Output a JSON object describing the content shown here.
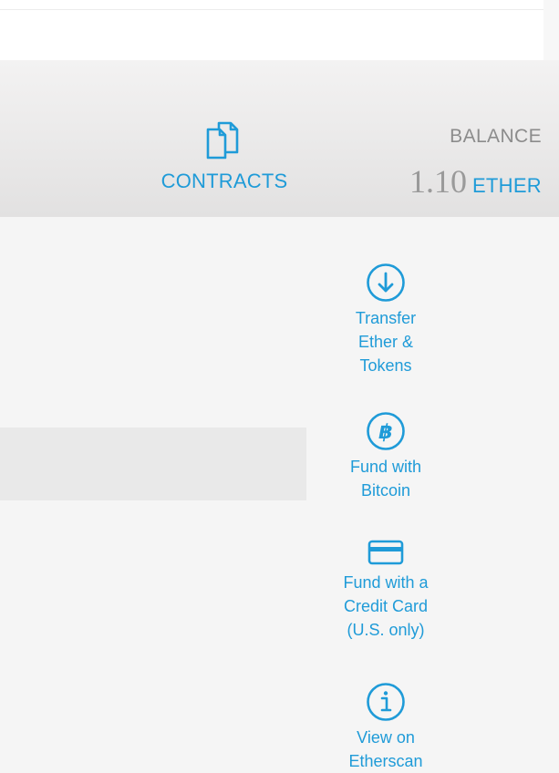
{
  "header": {
    "contracts_label": "CONTRACTS",
    "contracts_icon": "contracts-icon",
    "balance_label": "BALANCE",
    "balance_value": "1.10",
    "balance_unit": "ETHER"
  },
  "actions": [
    {
      "label_lines": [
        "Transfer",
        "Ether &",
        "Tokens"
      ],
      "icon": "arrow-down-circle-icon"
    },
    {
      "label_lines": [
        "Fund with",
        "Bitcoin"
      ],
      "icon": "bitcoin-icon"
    },
    {
      "label_lines": [
        "Fund with a",
        "Credit Card",
        "(U.S. only)"
      ],
      "icon": "credit-card-icon"
    },
    {
      "label_lines": [
        "View on",
        "Etherscan"
      ],
      "icon": "info-icon"
    }
  ],
  "colors": {
    "accent": "#1f9bd8",
    "muted_text": "#8c8c8c",
    "header_background": "#e8e7e7",
    "page_background": "#f5f5f5"
  }
}
